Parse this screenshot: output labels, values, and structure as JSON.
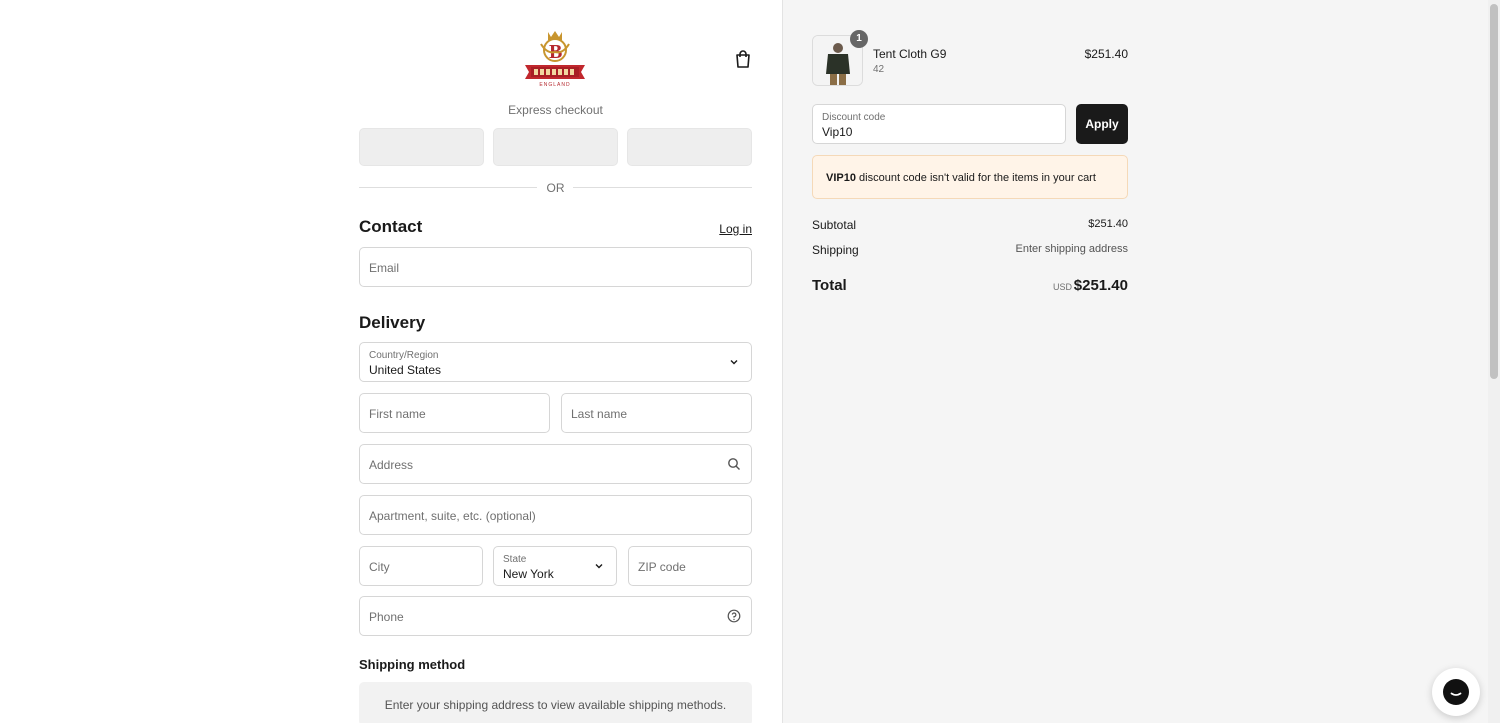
{
  "header": {
    "logo_text": "ENGLAND",
    "cart_icon": "shopping-bag-icon"
  },
  "express": {
    "label": "Express checkout",
    "or_text": "OR"
  },
  "contact": {
    "title": "Contact",
    "login_label": "Log in",
    "email_placeholder": "Email"
  },
  "delivery": {
    "title": "Delivery",
    "country_label": "Country/Region",
    "country_value": "United States",
    "first_name_placeholder": "First name",
    "last_name_placeholder": "Last name",
    "address_placeholder": "Address",
    "apartment_placeholder": "Apartment, suite, etc. (optional)",
    "city_placeholder": "City",
    "state_label": "State",
    "state_value": "New York",
    "zip_placeholder": "ZIP code",
    "phone_placeholder": "Phone"
  },
  "shipping_method": {
    "title": "Shipping method",
    "message": "Enter your shipping address to view available shipping methods."
  },
  "order": {
    "item": {
      "quantity": "1",
      "name": "Tent Cloth G9",
      "variant": "42",
      "price": "$251.40"
    },
    "discount_label": "Discount code",
    "discount_value": "Vip10",
    "apply_label": "Apply",
    "error_code": "VIP10",
    "error_message": " discount code isn't valid for the items in your cart",
    "subtotal_label": "Subtotal",
    "subtotal_value": "$251.40",
    "shipping_label": "Shipping",
    "shipping_value": "Enter shipping address",
    "total_label": "Total",
    "total_currency": "USD",
    "total_value": "$251.40"
  },
  "colors": {
    "accent": "#1a1a1a",
    "alert_bg": "#fff4e8",
    "summary_bg": "#f5f5f5"
  }
}
